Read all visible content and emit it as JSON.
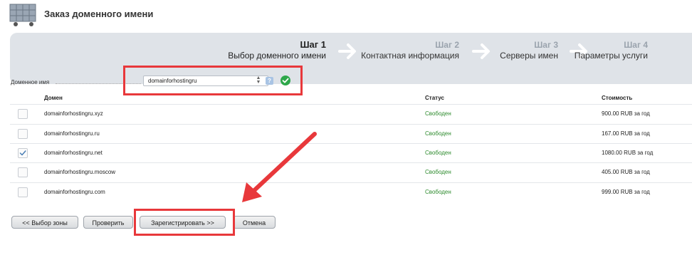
{
  "header": {
    "title": "Заказ доменного имени",
    "icon": "shopping-cart-icon"
  },
  "steps": [
    {
      "num": "Шаг 1",
      "label": "Выбор доменного имени",
      "active": true
    },
    {
      "num": "Шаг 2",
      "label": "Контактная информация",
      "active": false
    },
    {
      "num": "Шаг 3",
      "label": "Серверы имен",
      "active": false
    },
    {
      "num": "Шаг 4",
      "label": "Параметры услуги",
      "active": false
    }
  ],
  "domain_field": {
    "label": "Доменное имя",
    "value": "domainforhostingru",
    "help": "?"
  },
  "table": {
    "columns": [
      "Домен",
      "Статус",
      "Стоимость"
    ],
    "rows": [
      {
        "checked": false,
        "domain": "domainforhostingru.xyz",
        "status": "Свободен",
        "price": "900.00 RUB за год"
      },
      {
        "checked": false,
        "domain": "domainforhostingru.ru",
        "status": "Свободен",
        "price": "167.00 RUB за год"
      },
      {
        "checked": true,
        "domain": "domainforhostingru.net",
        "status": "Свободен",
        "price": "1080.00 RUB за год"
      },
      {
        "checked": false,
        "domain": "domainforhostingru.moscow",
        "status": "Свободен",
        "price": "405.00 RUB за год"
      },
      {
        "checked": false,
        "domain": "domainforhostingru.com",
        "status": "Свободен",
        "price": "999.00 RUB за год"
      }
    ]
  },
  "buttons": {
    "back": "<< Выбор зоны",
    "check": "Проверить",
    "register": "Зарегистрировать >>",
    "cancel": "Отмена"
  },
  "colors": {
    "status": "#2e8b2e",
    "highlight": "#e8383b",
    "banner": "#dfe3e8"
  }
}
